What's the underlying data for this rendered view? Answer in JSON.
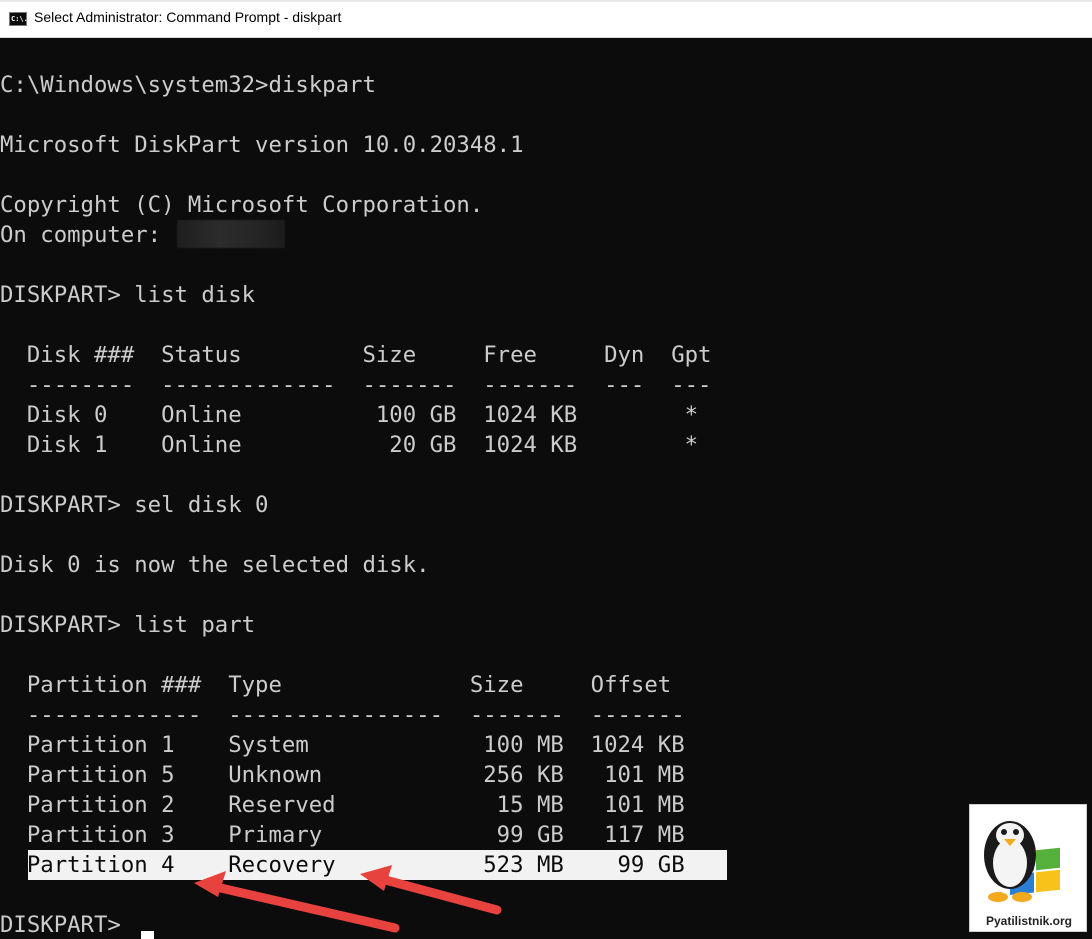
{
  "window": {
    "title": "Select Administrator: Command Prompt - diskpart",
    "app_icon_label": "C:\\."
  },
  "console": {
    "lines": [
      "C:\\Windows\\system32>diskpart",
      "",
      "Microsoft DiskPart version 10.0.20348.1",
      "",
      "Copyright (C) Microsoft Corporation.",
      "On computer: ",
      "",
      "DISKPART> list disk",
      "",
      "  Disk ###  Status         Size     Free     Dyn  Gpt",
      "  --------  -------------  -------  -------  ---  ---",
      "  Disk 0    Online          100 GB  1024 KB        *",
      "  Disk 1    Online           20 GB  1024 KB        *",
      "",
      "DISKPART> sel disk 0",
      "",
      "Disk 0 is now the selected disk.",
      "",
      "DISKPART> list part",
      "",
      "  Partition ###  Type              Size     Offset",
      "  -------------  ----------------  -------  -------",
      "  Partition 1    System             100 MB  1024 KB",
      "  Partition 5    Unknown            256 KB   101 MB",
      "  Partition 2    Reserved            15 MB   101 MB",
      "  Partition 3    Primary             99 GB   117 MB",
      "  Partition 4    Recovery           523 MB    99 GB",
      "",
      "DISKPART> "
    ],
    "highlighted_line_index": 26
  },
  "colors": {
    "console_bg": "#0c0c0c",
    "console_text": "#cccccc",
    "highlight_bg": "#f2f2f2",
    "arrow": "#e8423f"
  },
  "watermark": {
    "text": "Pyatilistnik.org"
  }
}
